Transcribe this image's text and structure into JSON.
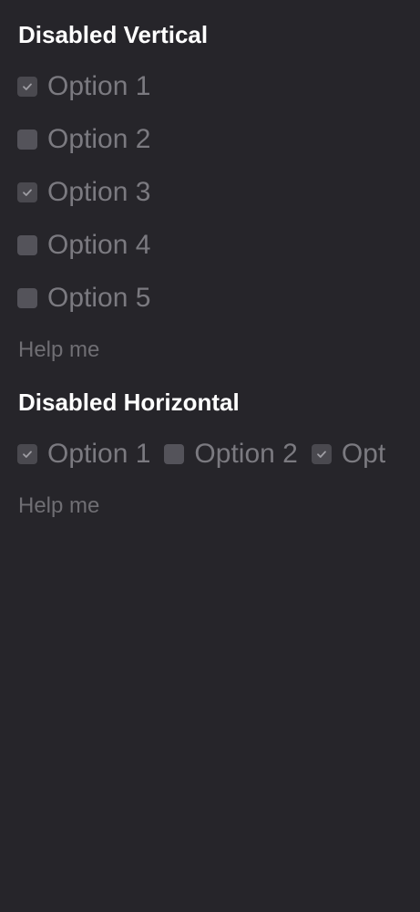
{
  "vertical_group": {
    "title": "Disabled Vertical",
    "options": [
      {
        "label": "Option 1",
        "checked": true
      },
      {
        "label": "Option 2",
        "checked": false
      },
      {
        "label": "Option 3",
        "checked": true
      },
      {
        "label": "Option 4",
        "checked": false
      },
      {
        "label": "Option 5",
        "checked": false
      }
    ],
    "help_text": "Help me",
    "disabled": true
  },
  "horizontal_group": {
    "title": "Disabled Horizontal",
    "options": [
      {
        "label": "Option 1",
        "checked": true
      },
      {
        "label": "Option 2",
        "checked": false
      },
      {
        "label": "Opt",
        "checked": true
      }
    ],
    "help_text": "Help me",
    "disabled": true
  },
  "icons": {
    "checked": "checkmark-icon"
  },
  "colors": {
    "background": "#26252a",
    "title": "#ffffff",
    "option_text": "#7b7a80",
    "help_text": "#6f6e73",
    "checkbox": "#54535a"
  }
}
